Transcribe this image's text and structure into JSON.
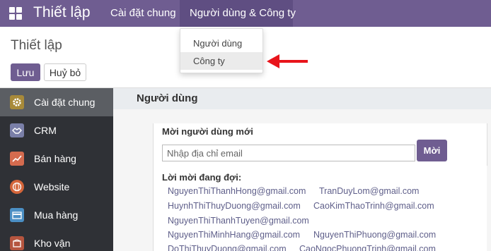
{
  "navbar": {
    "app_title": "Thiết lập",
    "menus": [
      "Cài đặt chung",
      "Người dùng & Công ty"
    ],
    "dropdown_items": [
      "Người dùng",
      "Công ty"
    ],
    "accent_color": "#6f5d91"
  },
  "control_panel": {
    "title": "Thiết lập",
    "save_label": "Lưu",
    "discard_label": "Huỷ bỏ"
  },
  "sidebar": {
    "items": [
      {
        "label": "Cài đặt chung",
        "icon": "gear-icon",
        "active": true
      },
      {
        "label": "CRM",
        "icon": "handshake-icon"
      },
      {
        "label": "Bán hàng",
        "icon": "chart-icon"
      },
      {
        "label": "Website",
        "icon": "globe-icon"
      },
      {
        "label": "Mua hàng",
        "icon": "card-icon"
      },
      {
        "label": "Kho vận",
        "icon": "box-icon"
      }
    ]
  },
  "main": {
    "section_title": "Người dùng",
    "invite_label": "Mời người dùng mới",
    "email_placeholder": "Nhập địa chỉ email",
    "invite_button": "Mời",
    "pending_label": "Lời mời đang đợi:",
    "pending_emails": [
      "NguyenThiThanhHong@gmail.com",
      "TranDuyLom@gmail.com",
      "HuynhThiThuyDuong@gmail.com",
      "CaoKimThaoTrinh@gmail.com",
      "NguyenThiThanhTuyen@gmail.com",
      "NguyenThiMinhHang@gmail.com",
      "NguyenThiPhuong@gmail.com",
      "DoThiThuyDuong@gmail.com",
      "CaoNgocPhuongTrinh@gmail.com"
    ]
  }
}
